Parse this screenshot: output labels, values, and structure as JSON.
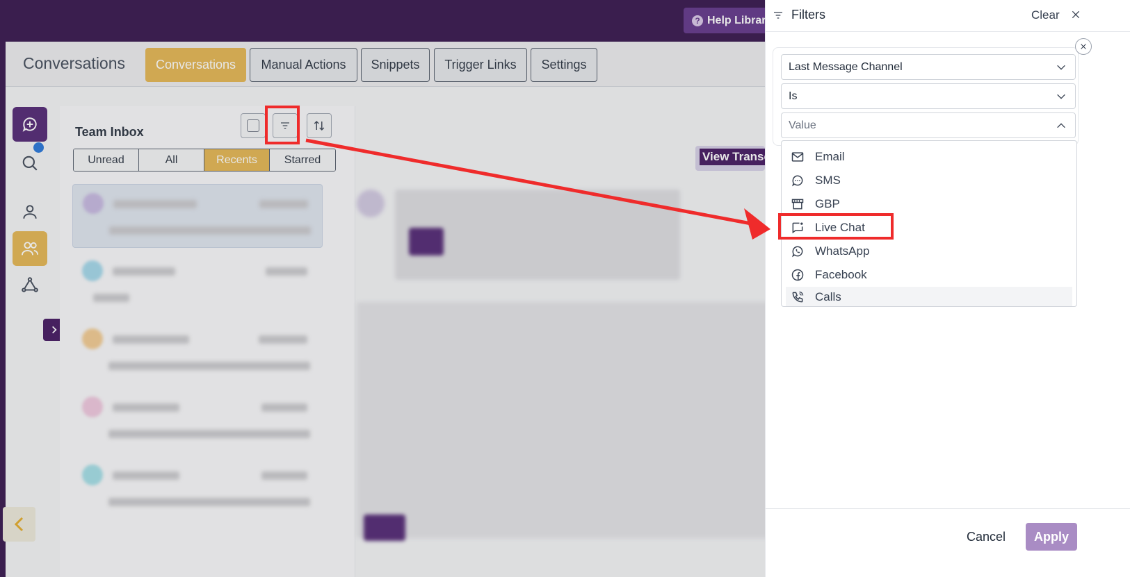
{
  "topbar": {
    "help_label": "Help Library",
    "help_glyph": "?"
  },
  "header": {
    "title": "Conversations",
    "tabs": [
      {
        "label": "Conversations",
        "active": true
      },
      {
        "label": "Manual Actions",
        "active": false
      },
      {
        "label": "Snippets",
        "active": false
      },
      {
        "label": "Trigger Links",
        "active": false
      },
      {
        "label": "Settings",
        "active": false
      }
    ]
  },
  "inbox": {
    "title": "Team Inbox",
    "segments": [
      {
        "label": "Unread",
        "active": false
      },
      {
        "label": "All",
        "active": false
      },
      {
        "label": "Recents",
        "active": true
      },
      {
        "label": "Starred",
        "active": false
      }
    ]
  },
  "chat": {
    "view_transcript_label": "View Transcript"
  },
  "filters": {
    "title": "Filters",
    "clear_label": "Clear",
    "field_select": "Last Message Channel",
    "operator_select": "Is",
    "value_placeholder": "Value",
    "options": [
      {
        "label": "Email",
        "icon": "mail-icon"
      },
      {
        "label": "SMS",
        "icon": "sms-icon"
      },
      {
        "label": "GBP",
        "icon": "store-icon"
      },
      {
        "label": "Live Chat",
        "icon": "live-chat-icon",
        "highlighted": true
      },
      {
        "label": "WhatsApp",
        "icon": "whatsapp-icon"
      },
      {
        "label": "Facebook",
        "icon": "facebook-icon"
      },
      {
        "label": "Calls",
        "icon": "phone-icon"
      }
    ],
    "cancel_label": "Cancel",
    "apply_label": "Apply"
  },
  "colors": {
    "brand_purple": "#2d0a45",
    "accent_gold": "#e3b34a",
    "annotation_red": "#ef2b2b",
    "apply_disabled": "#a98cc4"
  }
}
